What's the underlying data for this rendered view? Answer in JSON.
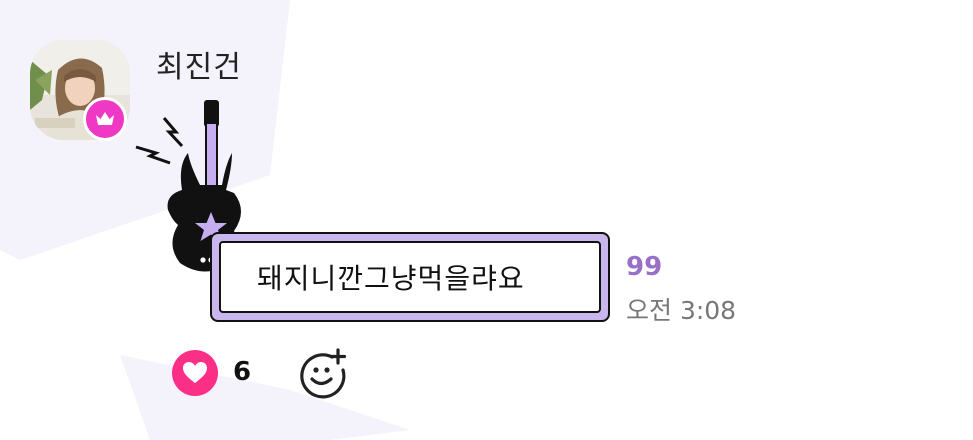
{
  "message": {
    "sender_name": "최진건",
    "text": "돼지니깐그냥먹을랴요",
    "unread_count": "99",
    "time": "오전 3:08"
  },
  "reactions": {
    "heart_count": "6"
  },
  "icons": {
    "badge": "crown-icon",
    "heart": "heart-icon",
    "add_reaction": "add-emoji-icon",
    "decoration": "guitar-icon"
  },
  "colors": {
    "badge": "#ef38c4",
    "bubble_frame": "#c9b6ec",
    "unread": "#9870c8",
    "heart": "#fc2f86",
    "background_star": "#f3f1fb"
  }
}
